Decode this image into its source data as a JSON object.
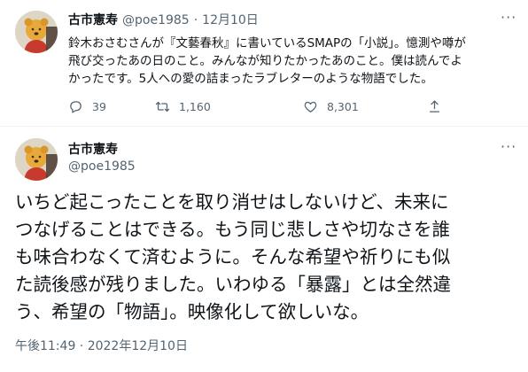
{
  "tweet1": {
    "author_name": "古市憲寿",
    "handle": "@poe1985",
    "separator": "·",
    "date": "12月10日",
    "body": "鈴木おさむさんが『文藝春秋』に書いているSMAPの「小説」。憶測や噂が\n飛び交ったあの日のこと。みんなが知りたかったあのこと。僕は読んでよ\nかったです。5人への愛の詰まったラブレターのような物語でした。",
    "replies": "39",
    "retweets": "1,160",
    "likes": "8,301",
    "more_icon": "ellipsis-icon"
  },
  "tweet2": {
    "author_name": "古市憲寿",
    "handle": "@poe1985",
    "body": "いちど起こったことを取り消せはしないけど、未来に\nつなげることはできる。もう同じ悲しさや切なさを誰\nも味合わなくて済むように。そんな希望や祈りにも似\nた読後感が残りました。いわゆる「暴露」とは全然違\nう、希望の「物語」。映像化して欲しいな。",
    "timestamp": "午後11:49 · 2022年12月10日",
    "more_icon": "ellipsis-icon"
  },
  "colors": {
    "text": "#0f1419",
    "muted": "#536471",
    "divider": "#eff3f4"
  }
}
